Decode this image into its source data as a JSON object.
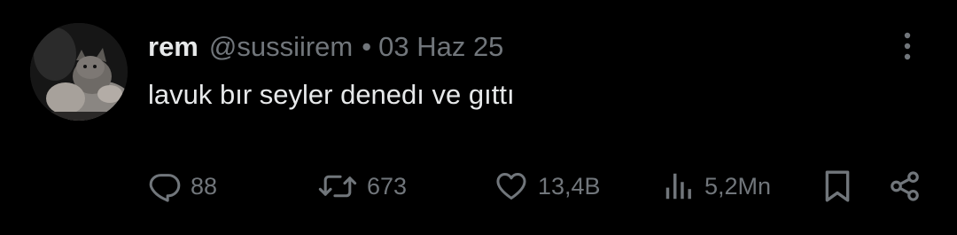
{
  "tweet": {
    "author": {
      "name": "rem",
      "handle": "@sussiirem",
      "avatar_icon": "avatar-photo-cat"
    },
    "separator": "•",
    "date": "03 Haz 25",
    "text": "lavuk bır seyler denedı ve gıttı",
    "more_icon": "more-vertical-icon",
    "actions": {
      "reply": {
        "icon": "reply-icon",
        "count": "88"
      },
      "retweet": {
        "icon": "retweet-icon",
        "count": "673"
      },
      "like": {
        "icon": "heart-icon",
        "count": "13,4B"
      },
      "views": {
        "icon": "views-icon",
        "count": "5,2Mn"
      },
      "bookmark": {
        "icon": "bookmark-icon"
      },
      "share": {
        "icon": "share-icon"
      }
    }
  },
  "colors": {
    "background": "#000000",
    "primary_text": "#e7e9ea",
    "secondary_text": "#71767b"
  }
}
